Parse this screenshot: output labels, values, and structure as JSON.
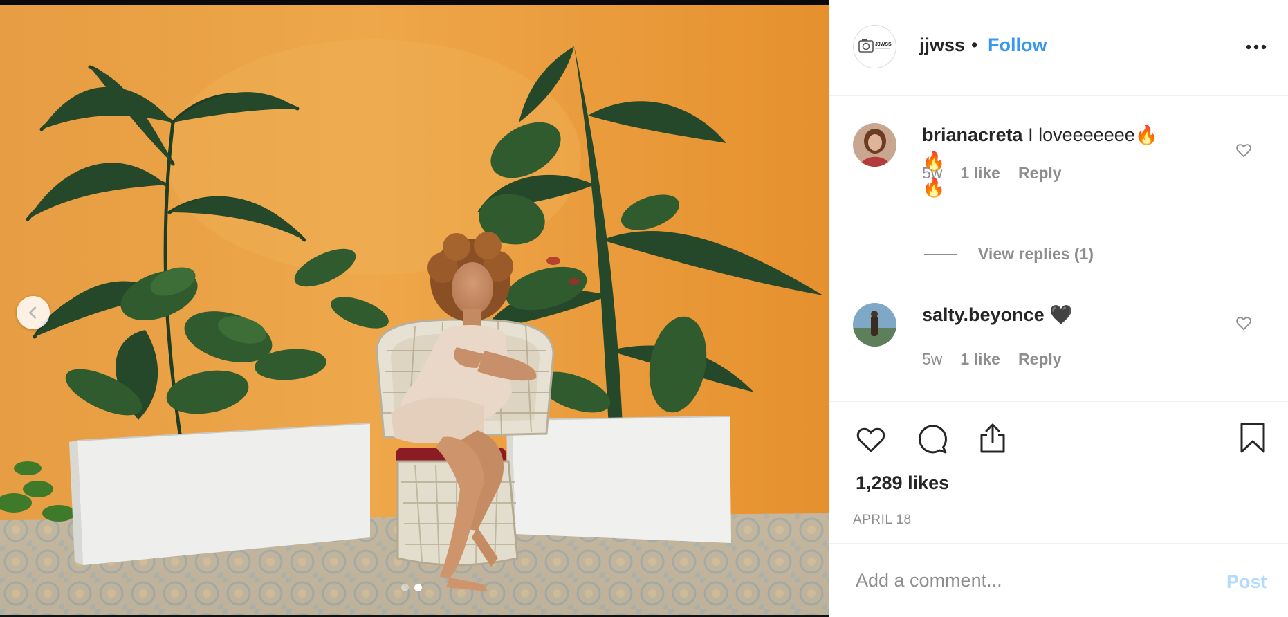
{
  "photo": {
    "alt": "",
    "carousel": {
      "count": 2,
      "active_index": 1
    }
  },
  "header": {
    "username": "jjwss",
    "bullet": "•",
    "follow_label": "Follow",
    "avatar_logo_text": "JJWSS"
  },
  "comments": [
    {
      "username": "brianacreta",
      "text_line1": "I loveeeeeee🔥 🔥",
      "text_line2": "🔥",
      "age": "5w",
      "likes": "1 like",
      "reply_label": "Reply",
      "view_replies": "View replies (1)"
    },
    {
      "username": "salty.beyonce",
      "text_line1": "🖤",
      "age": "5w",
      "likes": "1 like",
      "reply_label": "Reply"
    }
  ],
  "actions": {
    "icons": [
      "heart-icon",
      "comment-icon",
      "share-icon",
      "bookmark-icon"
    ],
    "likes_count": "1,289 likes",
    "date": "APRIL 18"
  },
  "comment_box": {
    "placeholder": "Add a comment...",
    "post_label": "Post"
  },
  "colors": {
    "accent": "#3897f0",
    "post_disabled": "#b3dbff",
    "text": "#262626",
    "muted": "#8e8e8e"
  }
}
